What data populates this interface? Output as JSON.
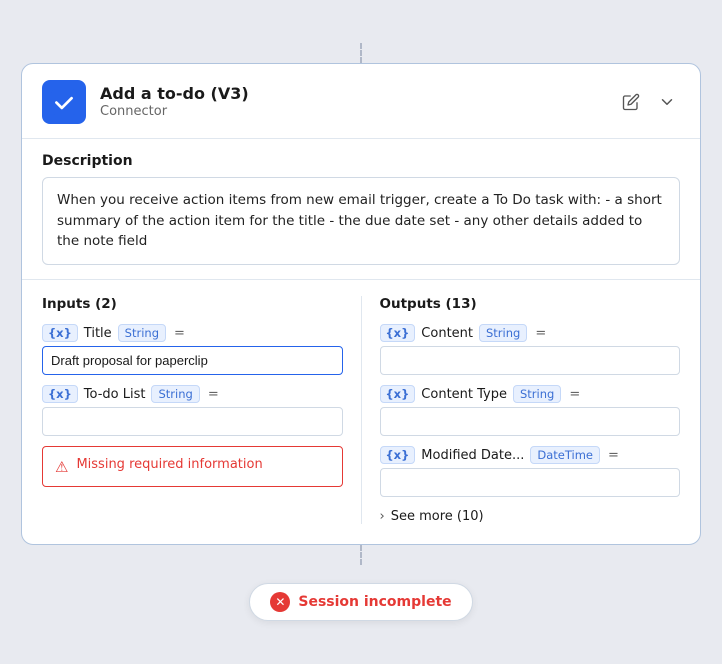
{
  "header": {
    "title": "Add a to-do (V3)",
    "subtitle": "Connector",
    "edit_icon": "✎",
    "expand_icon": "∨"
  },
  "description": {
    "label": "Description",
    "text": "When you receive action items from new email trigger, create a To Do task with: - a short summary of the action item for the title - the due date set - any other details added to the note field"
  },
  "inputs": {
    "col_title": "Inputs (2)",
    "fields": [
      {
        "badge": "{x}",
        "name": "Title",
        "type": "String",
        "equals": "=",
        "value": "Draft proposal for paperclip",
        "has_value": true
      },
      {
        "badge": "{x}",
        "name": "To-do List",
        "type": "String",
        "equals": "=",
        "value": "",
        "has_value": false
      }
    ],
    "error": {
      "text": "Missing required information"
    }
  },
  "outputs": {
    "col_title": "Outputs (13)",
    "fields": [
      {
        "badge": "{x}",
        "name": "Content",
        "type": "String",
        "equals": "=",
        "value": ""
      },
      {
        "badge": "{x}",
        "name": "Content Type",
        "type": "String",
        "equals": "=",
        "value": ""
      },
      {
        "badge": "{x}",
        "name": "Modified Date...",
        "type": "DateTime",
        "equals": "=",
        "value": ""
      }
    ],
    "see_more": "See more (10)"
  },
  "session": {
    "text": "Session incomplete",
    "icon": "✕"
  }
}
